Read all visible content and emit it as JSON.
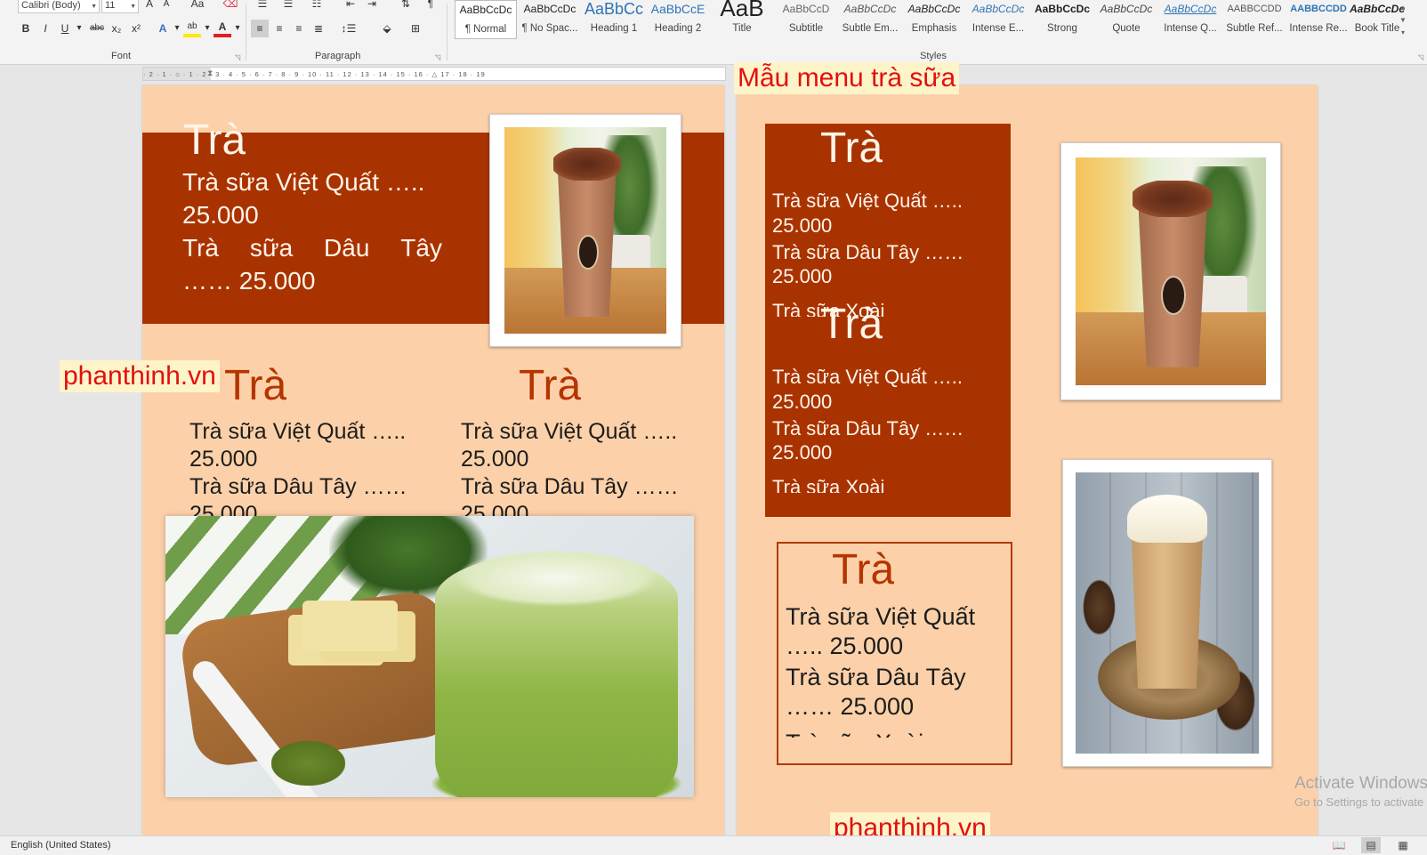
{
  "ribbon": {
    "font": {
      "name": "Calibri (Body)",
      "size": "11",
      "grow_glyph": "A",
      "shrink_glyph": "A",
      "case_glyph": "Aa",
      "bold": "B",
      "italic": "I",
      "underline": "U",
      "strike": "abc",
      "subscript": "x₂",
      "superscript": "x²",
      "effects_glyph": "A",
      "highlight_glyph": "ab",
      "color_glyph": "A",
      "font_color": "#e02020",
      "highlight_color": "#ffe900",
      "group_label": "Font"
    },
    "paragraph": {
      "group_label": "Paragraph",
      "pilcrow": "¶"
    },
    "styles": {
      "group_label": "Styles",
      "items": [
        {
          "sample": "AaBbCcDc",
          "name": "¶ Normal"
        },
        {
          "sample": "AaBbCcDc",
          "name": "¶ No Spac..."
        },
        {
          "sample": "AaBbCc",
          "name": "Heading 1"
        },
        {
          "sample": "AaBbCcE",
          "name": "Heading 2"
        },
        {
          "sample": "AaB",
          "name": "Title"
        },
        {
          "sample": "AaBbCcD",
          "name": "Subtitle"
        },
        {
          "sample": "AaBbCcDc",
          "name": "Subtle Em..."
        },
        {
          "sample": "AaBbCcDc",
          "name": "Emphasis"
        },
        {
          "sample": "AaBbCcDc",
          "name": "Intense E..."
        },
        {
          "sample": "AaBbCcDc",
          "name": "Strong"
        },
        {
          "sample": "AaBbCcDc",
          "name": "Quote"
        },
        {
          "sample": "AaBbCcDc",
          "name": "Intense Q..."
        },
        {
          "sample": "AABBCCDD",
          "name": "Subtle Ref..."
        },
        {
          "sample": "AABBCCDD",
          "name": "Intense Re..."
        },
        {
          "sample": "AaBbCcDc",
          "name": "Book Title"
        }
      ]
    }
  },
  "ruler": {
    "ticks": "· 2 · 1 · ⌂ · 1 · 2 · 3 · 4 · 5 · 6 · 7 · 8 · 9 · 10 · 11 · 12 · 13 · 14 · 15 · 16 · △ 17 · 18 · 19"
  },
  "watermarks": {
    "top_title": "Mẫu menu trà sữa",
    "site_left": "phanthinh.vn",
    "site_bottom": "phanthinh.vn"
  },
  "menu": {
    "title": "Trà",
    "item1_name": "Trà sữa Việt Quất",
    "item2_name": "Trà sữa Dâu Tây",
    "item3_name": "Trà sữa Xoài",
    "item1_line": "Trà sữa Việt Quất …..",
    "item2_line": "Trà sữa Dâu Tây ……",
    "dots5": "…..",
    "dots6": "……",
    "price": "25.000",
    "price_dots5": "….. 25.000",
    "price_dots6": "…… 25.000"
  },
  "activation": {
    "line1": "Activate Windows",
    "line2": "Go to Settings to activate Windows."
  },
  "statusbar": {
    "language": "English (United States)"
  },
  "colors": {
    "page_bg": "#fcd1a9",
    "band": "#a93300",
    "rust_text": "#b53400",
    "watermark_red": "#e30f0f"
  }
}
